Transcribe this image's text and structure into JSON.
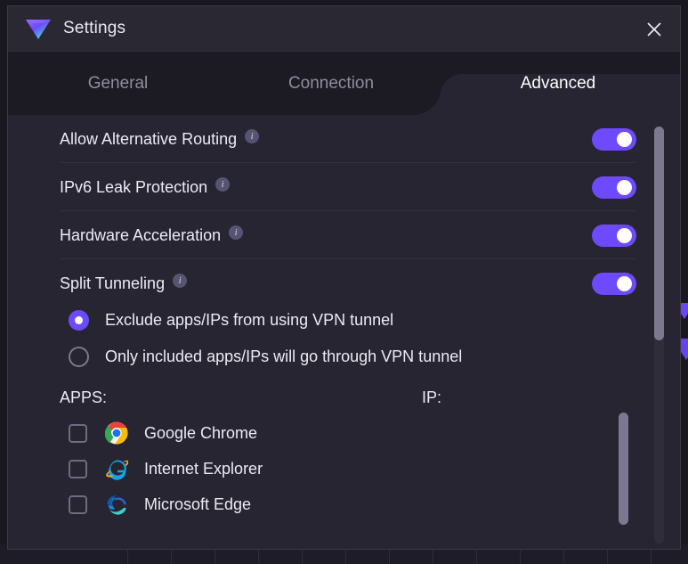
{
  "window": {
    "title": "Settings",
    "logo_icon": "protonvpn-logo-icon",
    "close_icon": "close-icon"
  },
  "colors": {
    "accent": "#6d4aff",
    "titlebar_bg": "#2a2833",
    "tabstrip_bg": "#1c1b24",
    "content_bg": "#272531",
    "text_primary": "#eceaf2",
    "text_muted": "#8f8d9e",
    "divider": "#33313f",
    "scrollbar_thumb": "#7b788f"
  },
  "tabs": [
    {
      "label": "General",
      "active": false
    },
    {
      "label": "Connection",
      "active": false
    },
    {
      "label": "Advanced",
      "active": true
    }
  ],
  "settings": [
    {
      "label": "Allow Alternative Routing",
      "info_icon": "info-icon",
      "toggle": "on"
    },
    {
      "label": "IPv6 Leak Protection",
      "info_icon": "info-icon",
      "toggle": "on"
    },
    {
      "label": "Hardware Acceleration",
      "info_icon": "info-icon",
      "toggle": "on"
    },
    {
      "label": "Split Tunneling",
      "info_icon": "info-icon",
      "toggle": "on"
    }
  ],
  "split_tunneling": {
    "options": [
      {
        "label": "Exclude apps/IPs from using VPN tunnel",
        "selected": true
      },
      {
        "label": "Only included apps/IPs will go through VPN tunnel",
        "selected": false
      }
    ],
    "apps_header": "APPS:",
    "ip_header": "IP:",
    "apps": [
      {
        "name": "Google Chrome",
        "icon": "chrome-icon",
        "checked": false
      },
      {
        "name": "Internet Explorer",
        "icon": "internet-explorer-icon",
        "checked": false
      },
      {
        "name": "Microsoft Edge",
        "icon": "microsoft-edge-icon",
        "checked": false
      }
    ],
    "ips": []
  }
}
